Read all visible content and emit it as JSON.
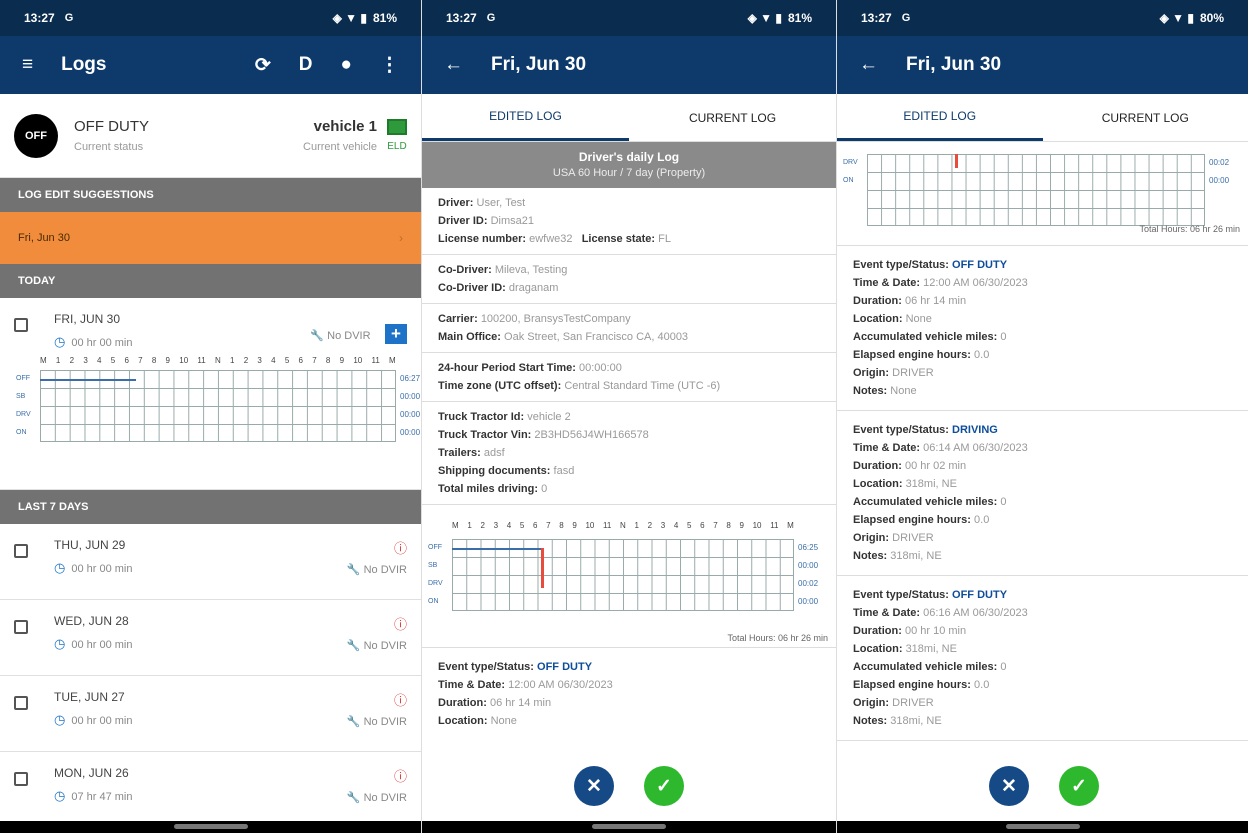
{
  "statusbar": {
    "time": "13:27",
    "s1_battery": "81%",
    "s2_battery": "81%",
    "s3_battery": "80%"
  },
  "screen1": {
    "appbar_title": "Logs",
    "current_status": "OFF DUTY",
    "current_status_label": "Current status",
    "status_circle": "OFF",
    "vehicle": "vehicle 1",
    "vehicle_label": "Current vehicle",
    "eld": "ELD",
    "log_edit_header": "LOG EDIT SUGGESTIONS",
    "suggestion": "Fri, Jun 30",
    "today_header": "TODAY",
    "last7_header": "LAST 7 DAYS",
    "today": {
      "day": "FRI, JUN 30",
      "duration": "00 hr 00 min",
      "dvir": "No DVIR",
      "totals": [
        "06:27",
        "00:00",
        "00:00",
        "00:00"
      ]
    },
    "days": [
      {
        "day": "THU, JUN 29",
        "duration": "00 hr 00 min",
        "dvir": "No DVIR"
      },
      {
        "day": "WED, JUN 28",
        "duration": "00 hr 00 min",
        "dvir": "No DVIR"
      },
      {
        "day": "TUE, JUN 27",
        "duration": "00 hr 00 min",
        "dvir": "No DVIR"
      },
      {
        "day": "MON, JUN 26",
        "duration": "07 hr 47 min",
        "dvir": "No DVIR"
      }
    ]
  },
  "graph": {
    "hours": [
      "M",
      "1",
      "2",
      "3",
      "4",
      "5",
      "6",
      "7",
      "8",
      "9",
      "10",
      "11",
      "N",
      "1",
      "2",
      "3",
      "4",
      "5",
      "6",
      "7",
      "8",
      "9",
      "10",
      "11",
      "M"
    ],
    "rows": [
      "OFF",
      "SB",
      "DRV",
      "ON"
    ]
  },
  "screen2": {
    "appbar_title": "Fri, Jun 30",
    "tab_edited": "EDITED LOG",
    "tab_current": "CURRENT LOG",
    "log_title": "Driver's daily Log",
    "log_subtitle": "USA 60 Hour / 7 day (Property)",
    "driver": "User, Test",
    "driver_id": "Dimsa21",
    "license_number": "ewfwe32",
    "license_state": "FL",
    "co_driver": "Mileva, Testing",
    "co_driver_id": "draganam",
    "carrier": "100200, BransysTestCompany",
    "main_office": "Oak Street, San Francisco CA, 40003",
    "period_start": "00:00:00",
    "time_zone": "Central Standard Time (UTC -6)",
    "tractor_id": "vehicle 2",
    "tractor_vin": "2B3HD56J4WH166578",
    "trailers": "adsf",
    "shipping_docs": "fasd",
    "total_miles": "0",
    "graph_totals": [
      "06:25",
      "00:00",
      "00:02",
      "00:00"
    ],
    "total_hours": "Total Hours: 06 hr 26 min",
    "event": {
      "status": "OFF DUTY",
      "time": "12:00 AM 06/30/2023",
      "duration": "06 hr 14 min",
      "location": "None"
    }
  },
  "screen3": {
    "graph_totals": [
      "00:02",
      "00:00"
    ],
    "total_hours": "Total Hours: 06 hr 26 min",
    "events": [
      {
        "status": "OFF DUTY",
        "time": "12:00 AM 06/30/2023",
        "duration": "06 hr 14 min",
        "location": "None",
        "miles": "0",
        "engine": "0.0",
        "origin": "DRIVER",
        "notes": "None"
      },
      {
        "status": "DRIVING",
        "time": "06:14 AM 06/30/2023",
        "duration": "00 hr 02 min",
        "location": "318mi, NE",
        "miles": "0",
        "engine": "0.0",
        "origin": "DRIVER",
        "notes": "318mi, NE"
      },
      {
        "status": "OFF DUTY",
        "time": "06:16 AM 06/30/2023",
        "duration": "00 hr 10 min",
        "location": "318mi, NE",
        "miles": "0",
        "engine": "0.0",
        "origin": "DRIVER",
        "notes": "318mi, NE"
      }
    ]
  },
  "labels": {
    "driver": "Driver:",
    "driver_id": "Driver ID:",
    "license_number": "License number:",
    "license_state": "License state:",
    "co_driver": "Co-Driver:",
    "co_driver_id": "Co-Driver ID:",
    "carrier": "Carrier:",
    "main_office": "Main Office:",
    "period_start": "24-hour Period Start Time:",
    "time_zone": "Time zone (UTC offset):",
    "tractor_id": "Truck Tractor Id:",
    "tractor_vin": "Truck Tractor Vin:",
    "trailers": "Trailers:",
    "shipping_docs": "Shipping documents:",
    "total_miles": "Total miles driving:",
    "event_status": "Event type/Status:",
    "time_date": "Time & Date:",
    "duration": "Duration:",
    "location": "Location:",
    "miles": "Accumulated vehicle miles:",
    "engine": "Elapsed engine hours:",
    "origin": "Origin:",
    "notes": "Notes:"
  },
  "colors": {
    "appbar": "#0d3a6b",
    "accent": "#1e73c8",
    "suggestion": "#f08c3c",
    "confirm": "#2eb82e",
    "cancel": "#154a86"
  },
  "icons": {
    "menu": "menu-icon",
    "sync": "sync-icon",
    "pin": "location-pin-icon",
    "more": "more-vert-icon",
    "back": "back-arrow-icon",
    "clock": "clock-icon",
    "wrench": "wrench-icon",
    "alert": "alert-icon"
  }
}
